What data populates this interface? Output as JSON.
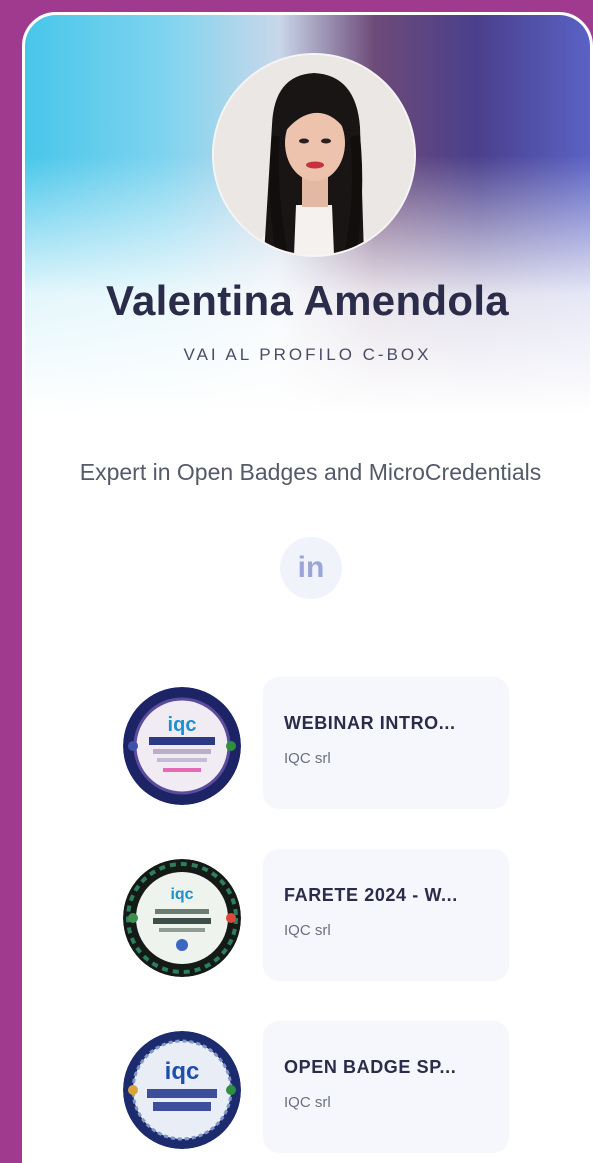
{
  "profile": {
    "name": "Valentina Amendola",
    "profile_link": "VAI AL PROFILO C-BOX",
    "tagline": "Expert in Open Badges and MicroCredentials"
  },
  "social": {
    "linkedin_label": "in"
  },
  "badges": [
    {
      "title": "WEBINAR INTRO...",
      "issuer": "IQC srl",
      "logo_text": "iqc",
      "ring_color": "#1c2466",
      "inner_color": "#f1ecf3"
    },
    {
      "title": "FARETE 2024 - W...",
      "issuer": "IQC srl",
      "logo_text": "iqc",
      "ring_color": "#141a17",
      "inner_color": "#eef3ee"
    },
    {
      "title": "OPEN BADGE SP...",
      "issuer": "IQC srl",
      "logo_text": "iqc",
      "ring_color": "#1c2a6e",
      "inner_color": "#e8edf6"
    }
  ],
  "colors": {
    "page_background": "#a03a8e",
    "name_text": "#2b2c49",
    "linkedin_icon": "#9aa6d8"
  }
}
